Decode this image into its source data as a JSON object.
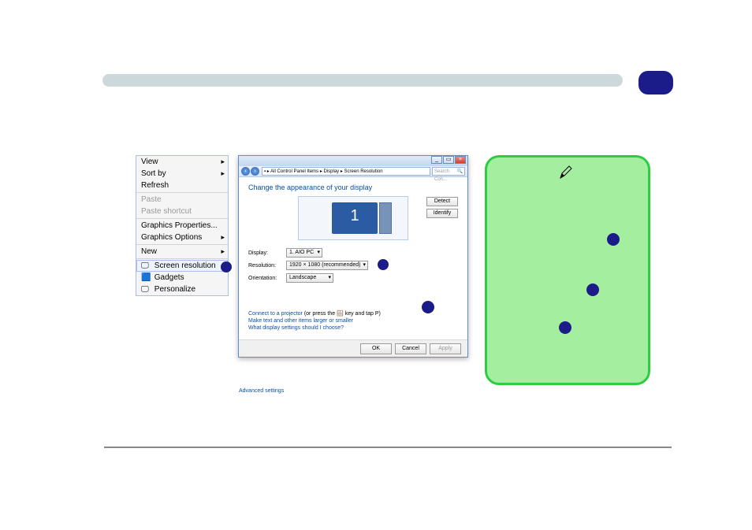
{
  "header": {
    "badge": ""
  },
  "context_menu": {
    "items": [
      {
        "label": "View",
        "submenu": true
      },
      {
        "label": "Sort by",
        "submenu": true
      },
      {
        "label": "Refresh"
      },
      {
        "label": "Paste",
        "disabled": true
      },
      {
        "label": "Paste shortcut",
        "disabled": true
      },
      {
        "label": "Graphics Properties..."
      },
      {
        "label": "Graphics Options",
        "submenu": true
      },
      {
        "label": "New",
        "submenu": true
      },
      {
        "label": "Screen resolution",
        "highlight": true
      },
      {
        "label": "Gadgets"
      },
      {
        "label": "Personalize"
      }
    ]
  },
  "window": {
    "breadcrumb": "▪  ▸ All Control Panel Items ▸ Display ▸ Screen Resolution",
    "search_placeholder": "Search Con...",
    "title": "Change the appearance of your display",
    "monitor_num": "1",
    "btn_detect": "Detect",
    "btn_identify": "Identify",
    "rows": {
      "display_label": "Display:",
      "display_value": "1. AIO PC",
      "resolution_label": "Resolution:",
      "resolution_value": "1920 × 1080 (recommended)",
      "orientation_label": "Orientation:",
      "orientation_value": "Landscape"
    },
    "advanced": "Advanced settings",
    "help_line1_a": "Connect to a projector",
    "help_line1_b": " (or press the 🪟 key and tap P)",
    "help_line2": "Make text and other items larger or smaller",
    "help_line3": "What display settings should I choose?",
    "btn_ok": "OK",
    "btn_cancel": "Cancel",
    "btn_apply": "Apply"
  }
}
